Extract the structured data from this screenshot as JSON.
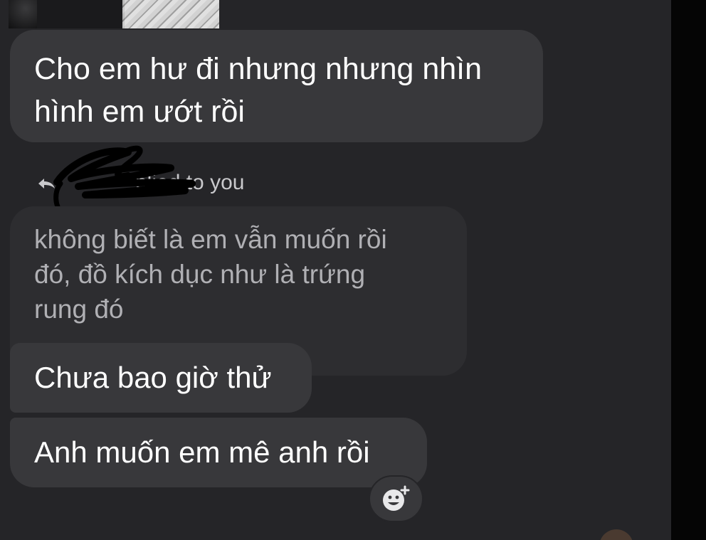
{
  "messages": {
    "msg1": {
      "line1": "Cho em hư đi nhưng nhưng nhìn",
      "line2": "hình em ướt rồi"
    },
    "reply_header": {
      "text": "plied to you",
      "icon": "reply-arrow-icon"
    },
    "quoted_message": {
      "line1": "không biết là em vẫn muốn rồi",
      "line2": "đó, đồ kích dục như là trứng",
      "line3": "rung đó"
    },
    "msg2": "Chưa bao giờ thử",
    "msg3": "Anh muốn em mê anh rồi"
  },
  "reaction_button": {
    "icon": "add-reaction-icon"
  },
  "colors": {
    "background": "#252528",
    "bubble": "#38383b",
    "quoted_bubble": "#2d2d30",
    "text": "#ffffff",
    "quoted_text": "#b0b0b4"
  }
}
